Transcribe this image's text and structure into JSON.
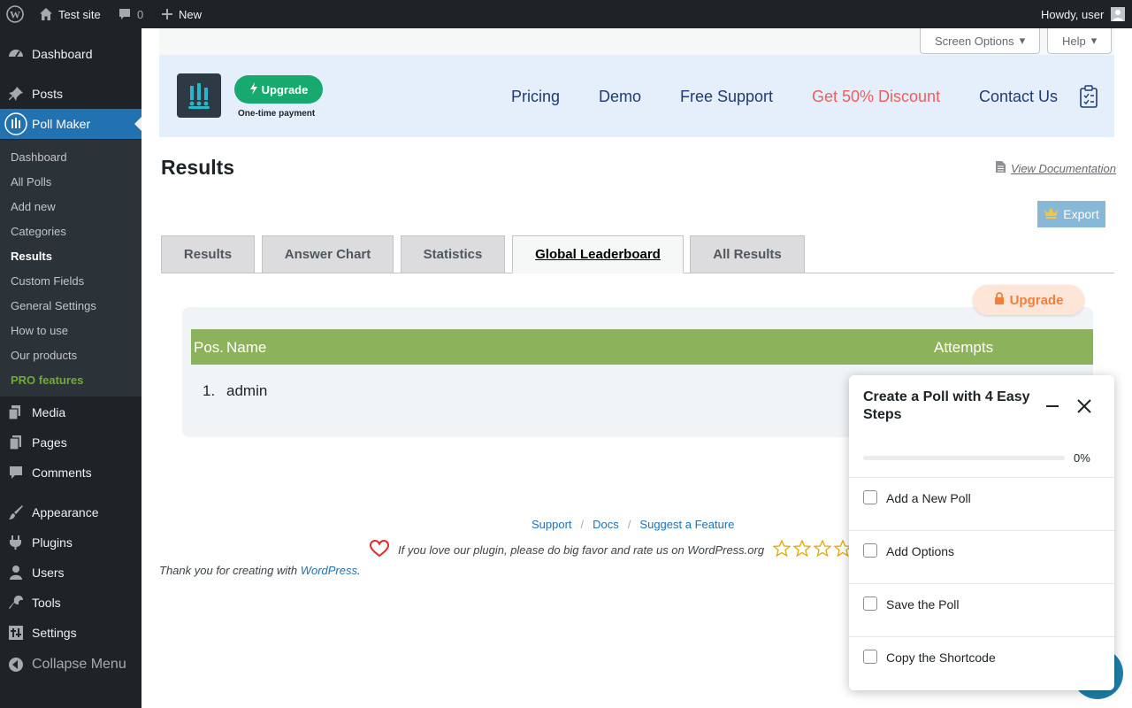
{
  "adminbar": {
    "site_name": "Test site",
    "comments_count": "0",
    "new_label": "New",
    "howdy": "Howdy, user"
  },
  "sidebar": {
    "items": [
      {
        "label": "Dashboard",
        "icon": "dashboard-icon"
      },
      {
        "label": "Posts",
        "icon": "pin-icon"
      },
      {
        "label": "Poll Maker",
        "icon": "poll-icon"
      },
      {
        "label": "Media",
        "icon": "media-icon"
      },
      {
        "label": "Pages",
        "icon": "pages-icon"
      },
      {
        "label": "Comments",
        "icon": "comment-icon"
      },
      {
        "label": "Appearance",
        "icon": "brush-icon"
      },
      {
        "label": "Plugins",
        "icon": "plug-icon"
      },
      {
        "label": "Users",
        "icon": "user-icon"
      },
      {
        "label": "Tools",
        "icon": "wrench-icon"
      },
      {
        "label": "Settings",
        "icon": "settings-icon"
      },
      {
        "label": "Collapse Menu",
        "icon": "collapse-icon"
      }
    ],
    "submenu": [
      "Dashboard",
      "All Polls",
      "Add new",
      "Categories",
      "Results",
      "Custom Fields",
      "General Settings",
      "How to use",
      "Our products",
      "PRO features"
    ],
    "current_submenu": "Results",
    "colors": {
      "bg": "#1d2327",
      "active": "#2271b1",
      "pro": "#72aa3a"
    }
  },
  "meta": {
    "screen_options": "Screen Options",
    "help": "Help"
  },
  "header": {
    "upgrade": "Upgrade",
    "one_time": "One-time payment",
    "nav": [
      "Pricing",
      "Demo",
      "Free Support",
      "Get 50% Discount",
      "Contact Us"
    ],
    "colors": {
      "bg": "#e5effc",
      "nav": "#1f3a76",
      "discount": "#f25c5c",
      "upgrade": "#17a96e"
    }
  },
  "page": {
    "title": "Results",
    "view_doc": "View Documentation",
    "export": "Export"
  },
  "tabs": [
    {
      "label": "Results",
      "active": false
    },
    {
      "label": "Answer Chart",
      "active": false
    },
    {
      "label": "Statistics",
      "active": false
    },
    {
      "label": "Global Leaderboard",
      "active": true
    },
    {
      "label": "All Results",
      "active": false
    }
  ],
  "leaderboard": {
    "upgrade": "Upgrade",
    "columns": [
      "Pos.",
      "Name",
      "Attempts"
    ],
    "rows": [
      {
        "pos": "1.",
        "name": "admin",
        "attempts": ""
      }
    ],
    "colors": {
      "head": "#8cb35b"
    }
  },
  "footer": {
    "links": [
      "Support",
      "Docs",
      "Suggest a Feature"
    ],
    "love": "If you love our plugin, please do big favor and rate us on WordPress.org",
    "thanks_prefix": "Thank you for creating with",
    "thanks_link": "WordPress",
    "thanks_suffix": "."
  },
  "onboarding": {
    "title": "Create a Poll with 4 Easy Steps",
    "progress": 0,
    "progress_label": "0%",
    "steps": [
      "Add a New Poll",
      "Add Options",
      "Save the Poll",
      "Copy the Shortcode"
    ]
  }
}
